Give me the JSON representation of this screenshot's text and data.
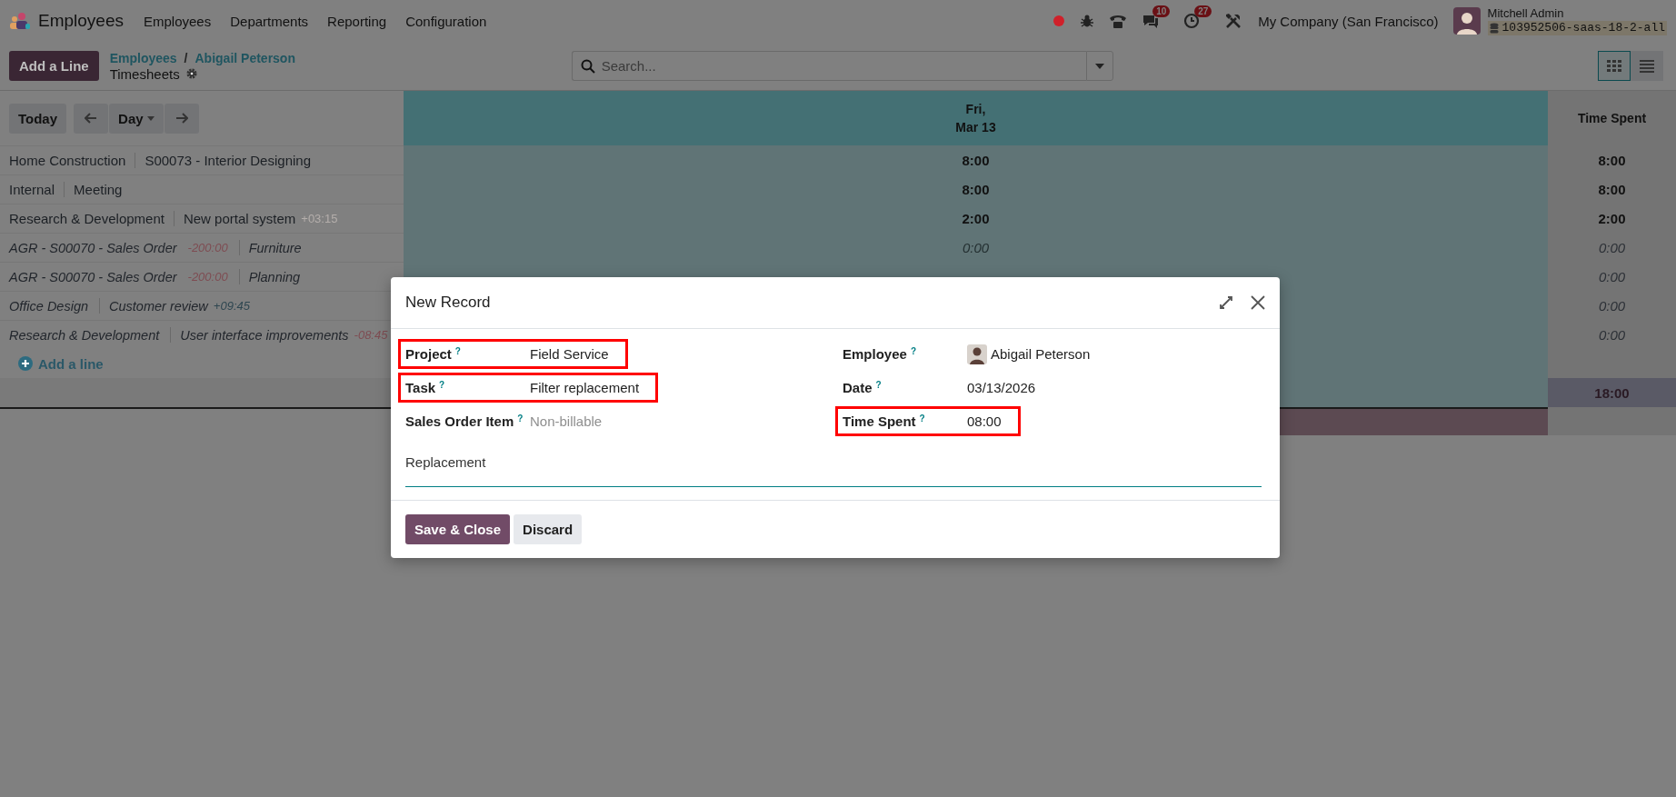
{
  "navbar": {
    "app_name": "Employees",
    "menu": [
      "Employees",
      "Departments",
      "Reporting",
      "Configuration"
    ],
    "chat_count": "10",
    "activity_count": "27",
    "company": "My Company (San Francisco)",
    "user_name": "Mitchell Admin",
    "database": "103952506-saas-18-2-all"
  },
  "control_panel": {
    "add_button": "Add a Line",
    "breadcrumbs": [
      "Employees",
      "Abigail Peterson"
    ],
    "breadcrumb_separator": "/",
    "title": "Timesheets",
    "search": {
      "placeholder": "Search..."
    },
    "views": [
      {
        "kind": "grid",
        "selected": true
      },
      {
        "kind": "list",
        "selected": false
      }
    ]
  },
  "grid": {
    "today_button": "Today",
    "range_button": "Day",
    "day_header": [
      "Fri,",
      "Mar 13"
    ],
    "total_header": "Time Spent",
    "rows": [
      {
        "project": "Home Construction",
        "task": "S00073 - Interior Designing",
        "day_value": "8:00",
        "total": "8:00",
        "empty": false
      },
      {
        "project": "Internal",
        "task": "Meeting",
        "day_value": "8:00",
        "total": "8:00",
        "empty": false
      },
      {
        "project": "Research & Development",
        "task": "New portal system",
        "task_badge": {
          "text": "+03:15",
          "color": "#b4aeab"
        },
        "day_value": "2:00",
        "total": "2:00",
        "empty": false
      },
      {
        "project": "AGR - S00070 - Sales Order",
        "project_badge": {
          "text": "-200:00",
          "color": "#7e4c52"
        },
        "task": "Furniture",
        "day_value": "0:00",
        "total": "0:00",
        "empty": true
      },
      {
        "project": "AGR - S00070 - Sales Order",
        "project_badge": {
          "text": "-200:00",
          "color": "#7e4c52"
        },
        "task": "Planning",
        "total": "0:00",
        "empty": true
      },
      {
        "project": "Office Design",
        "task": "Customer review",
        "task_badge": {
          "text": "+09:45",
          "color": "#2e4650"
        },
        "total": "0:00",
        "empty": true
      },
      {
        "project": "Research & Development",
        "task": "User interface improvements",
        "task_badge": {
          "text": "-08:45",
          "color": "#7e4c52"
        },
        "total": "0:00",
        "empty": true
      }
    ],
    "add_line": "Add a line",
    "grand_total": "18:00"
  },
  "dialog": {
    "title": "New Record",
    "left_fields": [
      {
        "label": "Project",
        "help": "?",
        "value": "Field Service",
        "kind": "text",
        "highlighted": true
      },
      {
        "label": "Task",
        "help": "?",
        "value": "Filter replacement",
        "kind": "text",
        "highlighted": true
      },
      {
        "label": "Sales Order Item",
        "help": "?",
        "placeholder": "Non-billable",
        "kind": "text",
        "highlighted": false
      }
    ],
    "right_fields": [
      {
        "label": "Employee",
        "help": "?",
        "value": "Abigail Peterson",
        "kind": "avatar",
        "highlighted": false
      },
      {
        "label": "Date",
        "help": "?",
        "value": "03/13/2026",
        "kind": "text",
        "highlighted": false
      },
      {
        "label": "Time Spent",
        "help": "?",
        "value": "08:00",
        "kind": "text",
        "highlighted": true
      }
    ],
    "description": {
      "value": "Replacement"
    },
    "buttons": [
      {
        "label": "Save & Close",
        "kind": "primary"
      },
      {
        "label": "Discard",
        "kind": "secondary"
      }
    ]
  }
}
